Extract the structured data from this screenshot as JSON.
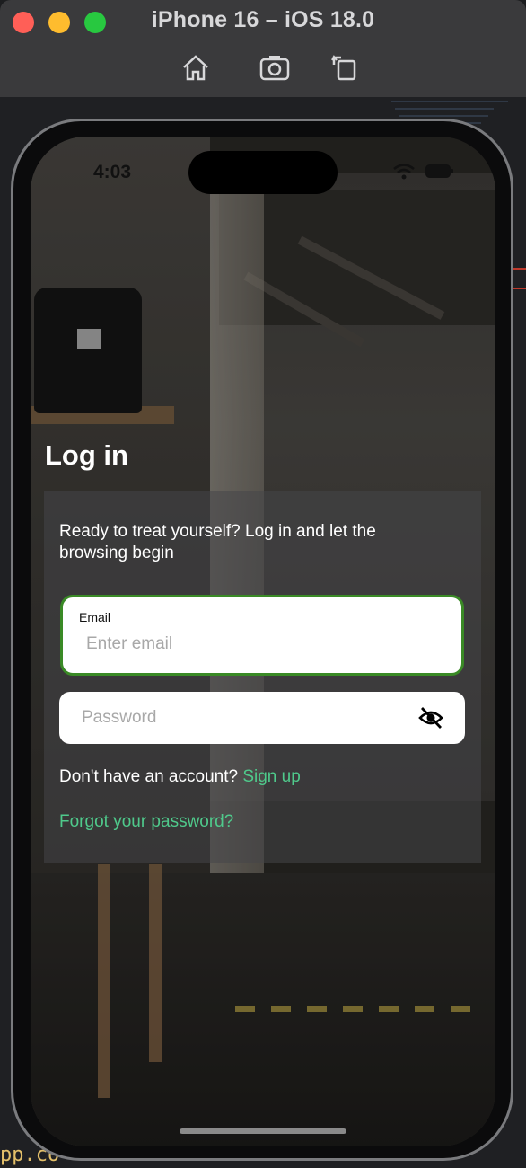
{
  "simulator": {
    "title": "iPhone 16 – iOS 18.0",
    "tools": [
      "home-icon",
      "screenshot-icon",
      "rotate-icon"
    ]
  },
  "status_bar": {
    "time": "4:03"
  },
  "login": {
    "title": "Log in",
    "subtitle": "Ready to treat yourself? Log in and let the browsing begin",
    "email_label": "Email",
    "email_placeholder": "Enter email",
    "email_value": "",
    "password_placeholder": "Password",
    "password_value": "",
    "signup_prompt": "Don't have an account?",
    "signup_link": "Sign up",
    "forgot_link": "Forgot your password?"
  },
  "ide": {
    "code_fragment": "pp.co"
  },
  "colors": {
    "accent_green": "#4fc98b",
    "focus_border": "#3a8a26"
  }
}
